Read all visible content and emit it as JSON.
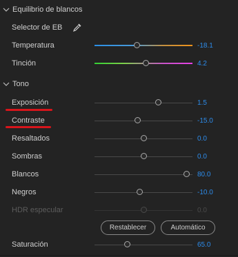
{
  "white_balance": {
    "title": "Equilibrio de blancos",
    "picker_label": "Selector de EB",
    "picker_icon": "eyedropper-icon",
    "temperature": {
      "label": "Temperatura",
      "value": "-18.1",
      "level": 0.43
    },
    "tint": {
      "label": "Tinción",
      "value": "4.2",
      "level": 0.52
    }
  },
  "tone": {
    "title": "Tono",
    "sliders": [
      {
        "key": "exposure",
        "label": "Exposición",
        "value": "1.5",
        "level": 0.65,
        "underlined": true
      },
      {
        "key": "contrast",
        "label": "Contraste",
        "value": "-15.0",
        "level": 0.44,
        "underlined": true
      },
      {
        "key": "highlights",
        "label": "Resaltados",
        "value": "0.0",
        "level": 0.5
      },
      {
        "key": "shadows",
        "label": "Sombras",
        "value": "0.0",
        "level": 0.5
      },
      {
        "key": "whites",
        "label": "Blancos",
        "value": "80.0",
        "level": 0.94
      },
      {
        "key": "blacks",
        "label": "Negros",
        "value": "-10.0",
        "level": 0.46
      },
      {
        "key": "hdr_specular",
        "label": "HDR especular",
        "value": "0.0",
        "level": 0.5,
        "disabled": true
      }
    ],
    "reset_button": "Restablecer",
    "auto_button": "Automático",
    "saturation": {
      "label": "Saturación",
      "value": "65.0",
      "level": 0.33
    }
  },
  "colors": {
    "background": "#232323",
    "text": "#cfcfcf",
    "value_blue": "#2d8ceb",
    "annotation_red": "#d8151b"
  }
}
